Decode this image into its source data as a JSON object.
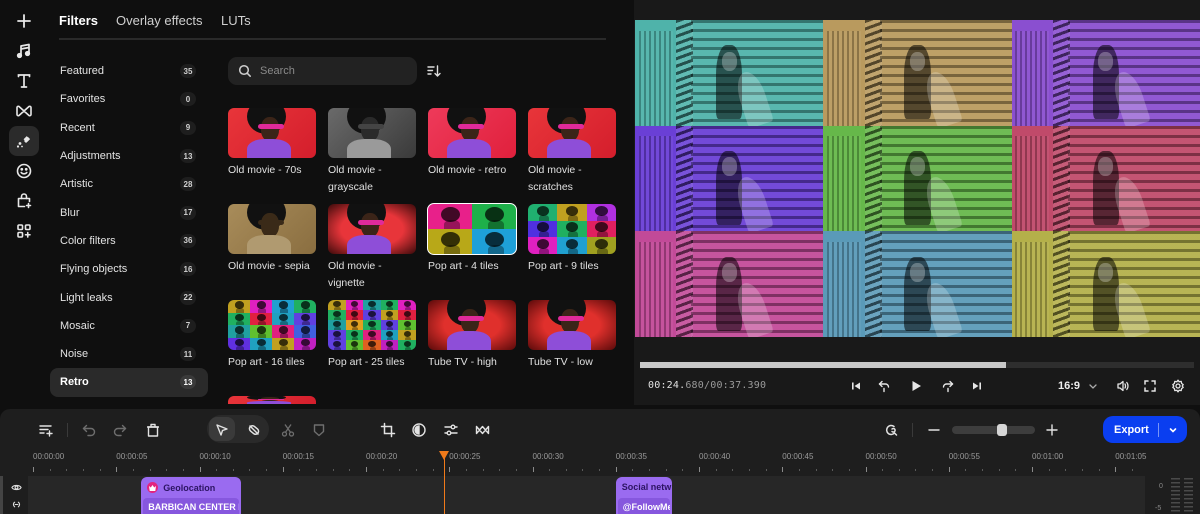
{
  "rail": {
    "items": [
      {
        "name": "add",
        "icon": "plus-icon"
      },
      {
        "name": "music",
        "icon": "music-note-icon"
      },
      {
        "name": "text",
        "icon": "text-icon"
      },
      {
        "name": "transitions",
        "icon": "bowtie-icon"
      },
      {
        "name": "effects",
        "icon": "magic-wand-icon",
        "active": true
      },
      {
        "name": "stickers",
        "icon": "smiley-icon"
      },
      {
        "name": "brand-kit",
        "icon": "bag-plus-icon"
      },
      {
        "name": "apps",
        "icon": "apps-plus-icon"
      }
    ]
  },
  "tabs": [
    {
      "label": "Filters",
      "active": true
    },
    {
      "label": "Overlay effects",
      "active": false
    },
    {
      "label": "LUTs",
      "active": false
    }
  ],
  "categories": [
    {
      "label": "Featured",
      "count": "35"
    },
    {
      "label": "Favorites",
      "count": "0"
    },
    {
      "label": "Recent",
      "count": "9"
    },
    {
      "label": "Adjustments",
      "count": "13"
    },
    {
      "label": "Artistic",
      "count": "28"
    },
    {
      "label": "Blur",
      "count": "17"
    },
    {
      "label": "Color filters",
      "count": "36"
    },
    {
      "label": "Flying objects",
      "count": "16"
    },
    {
      "label": "Light leaks",
      "count": "22"
    },
    {
      "label": "Mosaic",
      "count": "7"
    },
    {
      "label": "Noise",
      "count": "11"
    },
    {
      "label": "Retro",
      "count": "13",
      "active": true
    }
  ],
  "search": {
    "placeholder": "Search",
    "value": ""
  },
  "filters": [
    {
      "label": "Old movie - 70s",
      "style": "red"
    },
    {
      "label": "Old movie - grayscale",
      "style": "gray"
    },
    {
      "label": "Old movie - retro",
      "style": "pinkred"
    },
    {
      "label": "Old movie - scratches",
      "style": "red"
    },
    {
      "label": "Old movie - sepia",
      "style": "sepia"
    },
    {
      "label": "Old movie - vignette",
      "style": "vignette"
    },
    {
      "label": "Pop art - 4 tiles",
      "style": "tiles4",
      "selected": true
    },
    {
      "label": "Pop art - 9 tiles",
      "style": "tiles9"
    },
    {
      "label": "Pop art - 16 tiles",
      "style": "tiles16"
    },
    {
      "label": "Pop art - 25 tiles",
      "style": "tiles25"
    },
    {
      "label": "Tube TV - high",
      "style": "tube"
    },
    {
      "label": "Tube TV - low",
      "style": "tube"
    },
    {
      "label": "",
      "style": "red",
      "partial": true
    }
  ],
  "preview": {
    "tile_colors": [
      "#4fb3aa",
      "#b99a5e",
      "#8a4fd0",
      "#6a3fd6",
      "#66b84a",
      "#c04a6a",
      "#c24a98",
      "#5a9ab8",
      "#b4b04a"
    ],
    "progress": 0.66,
    "time_current": "00:24.",
    "time_current_ms": "680",
    "time_total": "/00:37.390",
    "aspect_ratio": "16:9"
  },
  "toolbar": {
    "export_label": "Export",
    "zoom_level": 0.62
  },
  "timeline": {
    "ticks": [
      "00:00:00",
      "00:00:05",
      "00:00:10",
      "00:00:15",
      "00:00:20",
      "00:00:25",
      "00:00:30",
      "00:00:35",
      "00:00:40",
      "00:00:45",
      "00:00:50",
      "00:00:55",
      "00:01:00",
      "00:01:05"
    ],
    "playhead_seconds": 24.68,
    "clips": [
      {
        "title": "Geolocation",
        "subtitle": "BARBICAN CENTER LC",
        "start": 5.0,
        "end": 11.0,
        "has_icon": true
      },
      {
        "title": "Social netw",
        "subtitle": "@FollowMe",
        "start": 33.5,
        "end": 36.9,
        "has_icon": false
      }
    ],
    "meter_labels": [
      "0",
      "-5"
    ]
  },
  "colors": {
    "accent": "#0a3ef0",
    "playhead": "#f07a1a",
    "clip": "#9a6bf0"
  }
}
